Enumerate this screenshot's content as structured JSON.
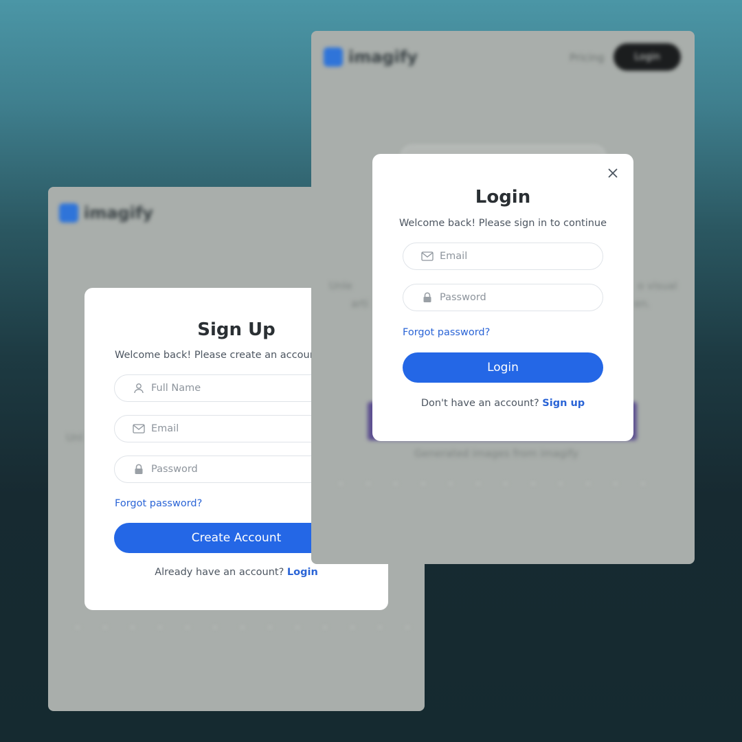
{
  "brand": {
    "name": "imagify"
  },
  "back_page": {
    "nav": {
      "pricing_label": "Pricing",
      "login_label": "Login"
    }
  },
  "signup": {
    "title": "Sign Up",
    "subtitle": "Welcome back! Please create an account to continue",
    "fullname_placeholder": "Full Name",
    "email_placeholder": "Email",
    "password_placeholder": "Password",
    "forgot_label": "Forgot password?",
    "submit_label": "Create Account",
    "footer_text": "Already have an account? ",
    "footer_link": "Login"
  },
  "login": {
    "title": "Login",
    "subtitle": "Welcome back! Please sign in to continue",
    "email_placeholder": "Email",
    "password_placeholder": "Password",
    "forgot_label": "Forgot password?",
    "submit_label": "Login",
    "footer_text": "Don't have an account? ",
    "footer_link": "Sign up",
    "close_icon": "close-icon"
  },
  "colors": {
    "primary": "#2467e6",
    "link": "#2a64d6",
    "overlay": "#a9aeab"
  }
}
